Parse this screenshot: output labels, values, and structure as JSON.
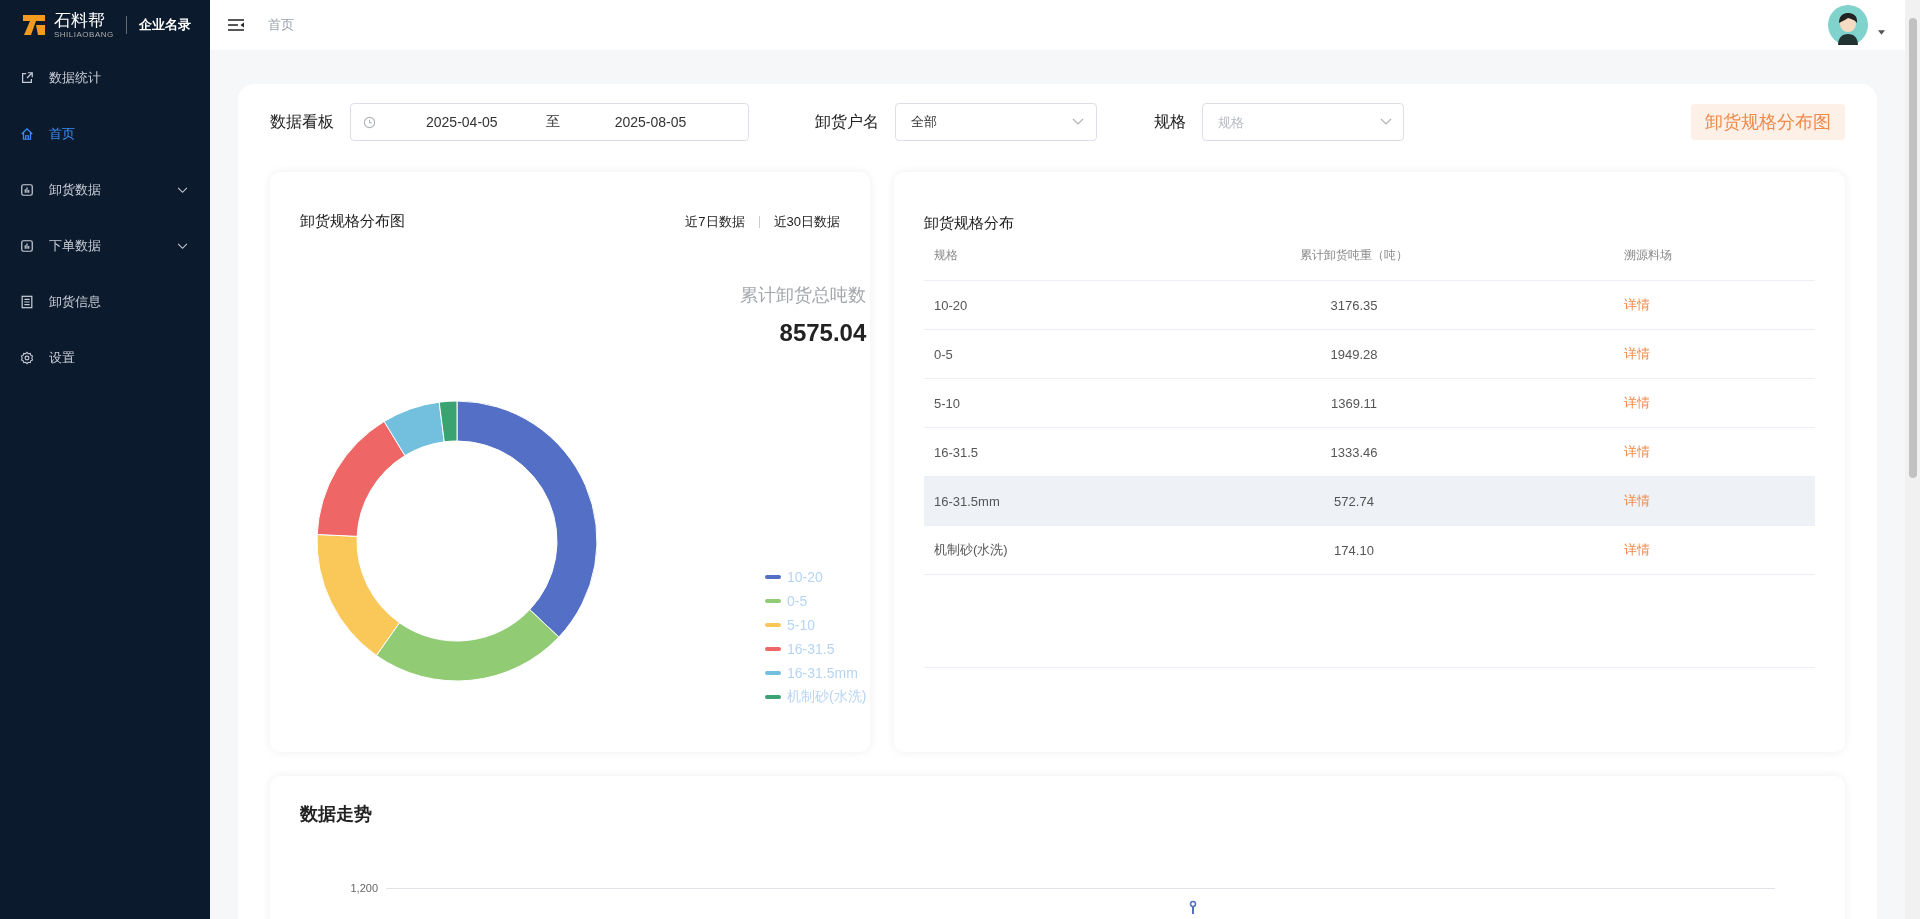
{
  "brand": {
    "name": "石料帮",
    "subtitle": "SHILIAOBANG",
    "company": "企业名录"
  },
  "sidebar": {
    "items": [
      {
        "label": "数据统计",
        "selected": false,
        "expandable": false
      },
      {
        "label": "首页",
        "selected": true,
        "expandable": false
      },
      {
        "label": "卸货数据",
        "selected": false,
        "expandable": true
      },
      {
        "label": "下单数据",
        "selected": false,
        "expandable": true
      },
      {
        "label": "卸货信息",
        "selected": false,
        "expandable": false
      },
      {
        "label": "设置",
        "selected": false,
        "expandable": false
      }
    ]
  },
  "header": {
    "breadcrumb": "首页"
  },
  "filters": {
    "board_label": "数据看板",
    "date_start": "2025-04-05",
    "date_sep": "至",
    "date_end": "2025-08-05",
    "unloader_label": "卸货户名",
    "unloader_value": "全部",
    "spec_label": "规格",
    "spec_placeholder": "规格",
    "action": "卸货规格分布图"
  },
  "distribution_card": {
    "title": "卸货规格分布图",
    "ranges": [
      {
        "label": "近7日数据",
        "selected": false
      },
      {
        "label": "近30日数据",
        "selected": false
      }
    ],
    "total_label": "累计卸货总吨数",
    "total_value": "8575.04",
    "chart_data": {
      "type": "donut",
      "categories": [
        "10-20",
        "0-5",
        "5-10",
        "16-31.5",
        "16-31.5mm",
        "机制砂(水洗)"
      ],
      "values": [
        37.04,
        22.73,
        15.97,
        15.55,
        6.68,
        2.03
      ],
      "colors": [
        "#5470c6",
        "#91cc75",
        "#fac858",
        "#ee6666",
        "#73c0de",
        "#3ba272"
      ]
    }
  },
  "table_card": {
    "title": "卸货规格分布",
    "columns": [
      "规格",
      "累计卸货吨重（吨）",
      "溯源料场"
    ],
    "rows": [
      {
        "spec": "10-20",
        "weight": "3176.35",
        "link": "详情",
        "selected": false
      },
      {
        "spec": "0-5",
        "weight": "1949.28",
        "link": "详情",
        "selected": false
      },
      {
        "spec": "5-10",
        "weight": "1369.11",
        "link": "详情",
        "selected": false
      },
      {
        "spec": "16-31.5",
        "weight": "1333.46",
        "link": "详情",
        "selected": false
      },
      {
        "spec": "16-31.5mm",
        "weight": "572.74",
        "link": "详情",
        "selected": true
      },
      {
        "spec": "机制砂(水洗)",
        "weight": "174.10",
        "link": "详情",
        "selected": false
      }
    ]
  },
  "trend_card": {
    "title": "数据走势",
    "y_tick": "1,200"
  }
}
